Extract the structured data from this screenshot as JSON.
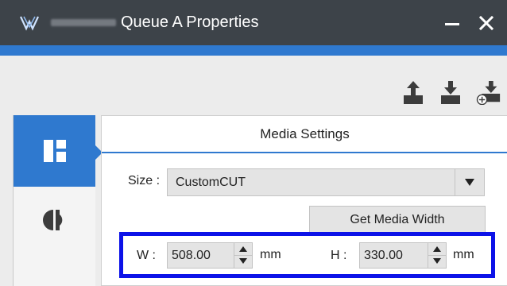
{
  "window": {
    "title": "Queue A Properties",
    "minimize_label": "—",
    "close_label": "✕"
  },
  "toolbar": {
    "buttons": [
      {
        "icon": "export-icon"
      },
      {
        "icon": "import-icon"
      },
      {
        "icon": "import-add-icon"
      }
    ]
  },
  "tabs": [
    {
      "icon": "media-layout-icon",
      "active": true
    },
    {
      "icon": "color-half-icon",
      "active": false
    }
  ],
  "panel": {
    "header": "Media Settings",
    "size_label": "Size :",
    "size_value": "CustomCUT",
    "get_media_width_label": "Get Media Width",
    "width_label": "W :",
    "width_value": "508.00",
    "width_unit": "mm",
    "height_label": "H :",
    "height_value": "330.00",
    "height_unit": "mm"
  },
  "colors": {
    "titlebar": "#3d4349",
    "accent": "#2f79cf",
    "highlight_border": "#0c12e8"
  }
}
